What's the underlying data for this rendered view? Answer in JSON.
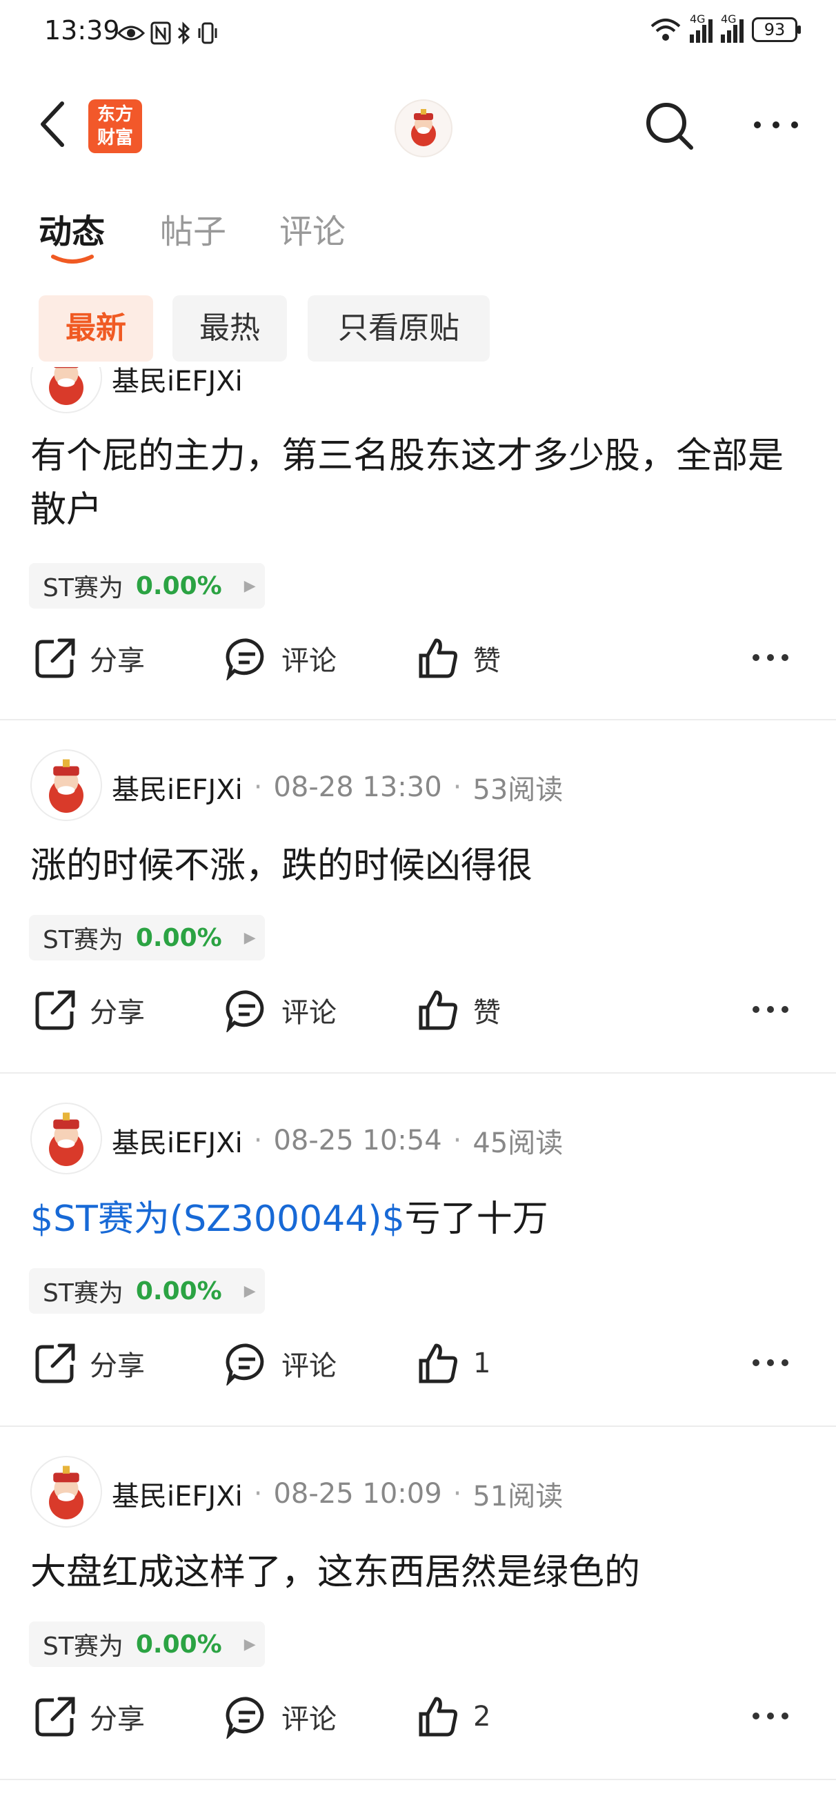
{
  "status_bar": {
    "time": "13:39",
    "battery": "93",
    "net1": "4G",
    "net2": "4G"
  },
  "nav": {
    "logo_line1": "东方",
    "logo_line2": "财富"
  },
  "tabs": [
    {
      "label": "动态",
      "active": true
    },
    {
      "label": "帖子",
      "active": false
    },
    {
      "label": "评论",
      "active": false
    }
  ],
  "filters": [
    {
      "label": "最新",
      "active": true
    },
    {
      "label": "最热",
      "active": false
    },
    {
      "label": "只看原贴",
      "active": false
    }
  ],
  "actions": {
    "share_label": "分享",
    "comment_label": "评论",
    "like_label": "赞"
  },
  "posts": [
    {
      "user": "基民iEFJXi",
      "date": "",
      "reads": "",
      "content_prefix": "",
      "content": "有个屁的主力，第三名股东这才多少股，全部是散户",
      "stock": {
        "name": "ST赛为",
        "change": "0.00%"
      },
      "likes": "赞"
    },
    {
      "user": "基民iEFJXi",
      "date": "08-28 13:30",
      "reads": "53阅读",
      "content_prefix": "",
      "content": "涨的时候不涨，跌的时候凶得很",
      "stock": {
        "name": "ST赛为",
        "change": "0.00%"
      },
      "likes": "赞"
    },
    {
      "user": "基民iEFJXi",
      "date": "08-25 10:54",
      "reads": "45阅读",
      "content_prefix": "$ST赛为(SZ300044)$",
      "content": "亏了十万",
      "stock": {
        "name": "ST赛为",
        "change": "0.00%"
      },
      "likes": "1"
    },
    {
      "user": "基民iEFJXi",
      "date": "08-25 10:09",
      "reads": "51阅读",
      "content_prefix": "",
      "content": "大盘红成这样了，这东西居然是绿色的",
      "stock": {
        "name": "ST赛为",
        "change": "0.00%"
      },
      "likes": "2"
    }
  ],
  "colors": {
    "accent": "#f05a23",
    "logo_bg": "#f2582a",
    "stock_up_zero": "#2ba343",
    "link": "#1769d6"
  }
}
